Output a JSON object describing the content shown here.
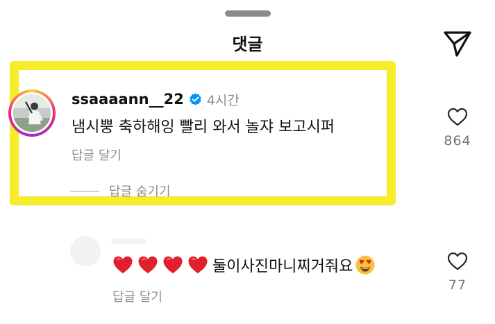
{
  "sheet": {
    "title": "댓글",
    "icons": {
      "handle": "drag-handle",
      "share": "paper-plane-icon"
    }
  },
  "colors": {
    "highlight": "#f6ec2a",
    "verified": "#0095f6",
    "muted_text": "#8e8e8e",
    "heart_emoji": "#e0202c"
  },
  "comments": [
    {
      "username": "ssaaaann__22",
      "verified": true,
      "time": "4시간",
      "text": "냄시뿡 축하해잉 빨리 와서 놀쟈 보고시퍼",
      "reply_label": "답글 달기",
      "hide_replies_label": "답글 숨기기",
      "likes": "864",
      "highlighted": true
    },
    {
      "emoji_prefix": [
        "red-heart",
        "red-heart",
        "red-heart",
        "red-heart"
      ],
      "text": "둘이사진마니찌거줘요",
      "emoji_suffix": "heart-eyes-face",
      "reply_label": "답글 달기",
      "likes": "77"
    }
  ]
}
